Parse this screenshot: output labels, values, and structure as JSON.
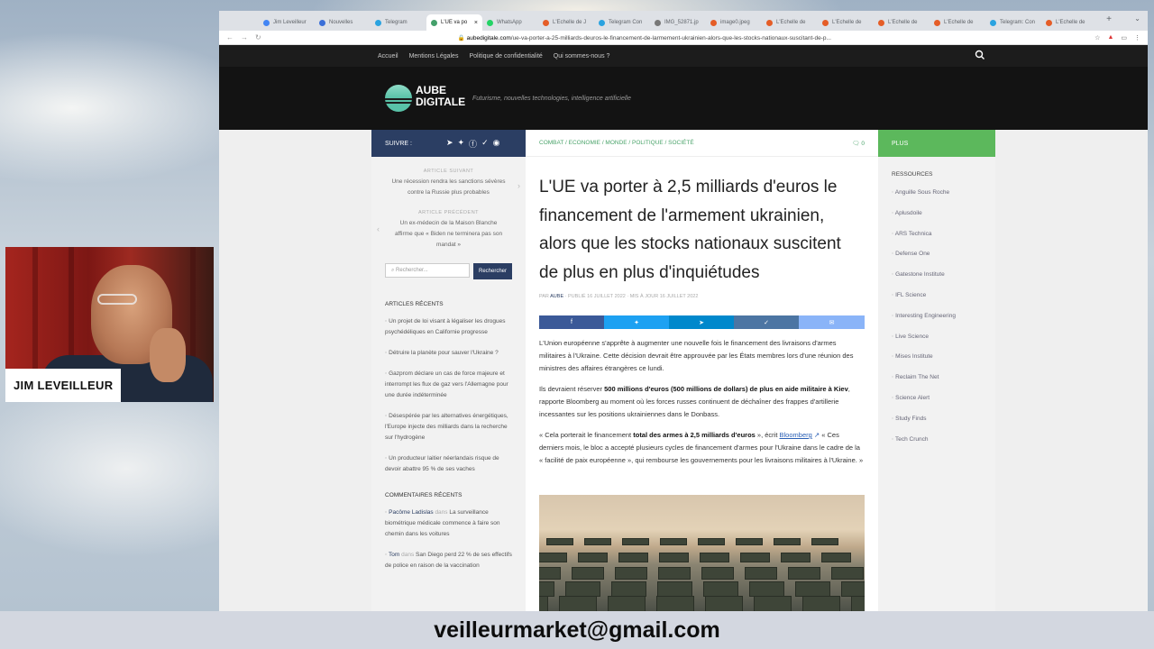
{
  "browser": {
    "tabs": [
      {
        "label": "Jim Leveilleur",
        "color": "#4285f4"
      },
      {
        "label": "Nouvelles",
        "color": "#3a6fd8"
      },
      {
        "label": "Telegram",
        "color": "#2aa3e0"
      },
      {
        "label": "L'UE va po",
        "color": "#44a06b",
        "active": true
      },
      {
        "label": "WhatsApp",
        "color": "#25d366"
      },
      {
        "label": "L'Echelle de J",
        "color": "#e55d27"
      },
      {
        "label": "Telegram Con",
        "color": "#2aa3e0"
      },
      {
        "label": "IMG_52871.jp",
        "color": "#777777"
      },
      {
        "label": "image0.jpeg",
        "color": "#e55d27"
      },
      {
        "label": "L'Echelle de",
        "color": "#e55d27"
      },
      {
        "label": "L'Echelle de",
        "color": "#e55d27"
      },
      {
        "label": "L'Echelle de",
        "color": "#e55d27"
      },
      {
        "label": "L'Echelle de",
        "color": "#e55d27"
      },
      {
        "label": "Telegram: Con",
        "color": "#2aa3e0"
      },
      {
        "label": "L'Echelle de",
        "color": "#e55d27"
      }
    ],
    "url_domain": "aubedigitale.com",
    "url_path": "/ue-va-porter-a-25-milliards-deuros-le-financement-de-larmement-ukrainien-alors-que-les-stocks-nationaux-suscitant-de-p..."
  },
  "site": {
    "topnav": [
      "Accueil",
      "Mentions Légales",
      "Politique de confidentialité",
      "Qui sommes-nous ?"
    ],
    "logo_line1": "AUBE",
    "logo_line2": "DIGITALE",
    "tagline": "Futurisme, nouvelles technologies, intelligence artificielle",
    "suivre": "SUIVRE :",
    "prev_label": "ARTICLE SUIVANT",
    "prev_text": "Une récession rendra les sanctions sévères contre la Russie plus probables",
    "next_label": "ARTICLE PRÉCÉDENT",
    "next_text": "Un ex-médecin de la Maison Blanche affirme que « Biden ne terminera pas son mandat »",
    "search_placeholder": "Rechercher...",
    "search_button": "Rechercher",
    "recent_title": "ARTICLES RÉCENTS",
    "recent": [
      "Un projet de loi visant à légaliser les drogues psychédéliques en Californie progresse",
      "Détruire la planète pour sauver l'Ukraine ?",
      "Gazprom déclare un cas de force majeure et interrompt les flux de gaz vers l'Allemagne pour une durée indéterminée",
      "Désespérée par les alternatives énergétiques, l'Europe injecte des milliards dans la recherche sur l'hydrogène",
      "Un producteur laitier néerlandais risque de devoir abattre 95 % de ses vaches"
    ],
    "comments_title": "COMMENTAIRES RÉCENTS",
    "comments": [
      {
        "author": "Pacôme Ladislas",
        "mid": "dans",
        "text": "La surveillance biométrique médicale commence à faire son chemin dans les voitures"
      },
      {
        "author": "Tom",
        "mid": "dans",
        "text": "San Diego perd 22 % de ses effectifs de police en raison de la vaccination"
      }
    ],
    "breadcrumb": "COMBAT / ECONOMIE / MONDE / POLITIQUE / SOCIÉTÉ",
    "comment_count": "0",
    "title": "L'UE va porter à 2,5 milliards d'euros le financement de l'armement ukrainien, alors que les stocks nationaux suscitent de plus en plus d'inquiétudes",
    "byline_prefix": "PAR",
    "byline_author": "AUBE",
    "byline_rest": "· PUBLIÉ 16 JUILLET 2022 · MIS À JOUR 16 JUILLET 2022",
    "share_colors": [
      "#3b5998",
      "#1da1f2",
      "#0088cc",
      "#4c75a3",
      "#8ab4f8"
    ],
    "p1": "L'Union européenne s'apprête à augmenter une nouvelle fois le financement des livraisons d'armes militaires à l'Ukraine. Cette décision devrait être approuvée par les États membres lors d'une réunion des ministres des affaires étrangères ce lundi.",
    "p2_a": "Ils devraient réserver ",
    "p2_b": "500 millions d'euros (500 millions de dollars) de plus en aide militaire à Kiev",
    "p2_c": ", rapporte Bloomberg au moment où les forces russes continuent de déchaîner des frappes d'artillerie incessantes sur les positions ukrainiennes dans le Donbass.",
    "p3_a": "« Cela porterait le financement ",
    "p3_b": "total des armes à 2,5 milliards d'euros",
    "p3_c": " », écrit ",
    "p3_link": "Bloomberg",
    "p3_d": " « Ces derniers mois, le bloc a accepté plusieurs cycles de financement d'armes pour l'Ukraine dans le cadre de la « facilité de paix européenne », qui rembourse les gouvernements pour les livraisons militaires à l'Ukraine. »",
    "plus": "PLUS",
    "resources_title": "RESSOURCES",
    "resources": [
      "Anguille Sous Roche",
      "Aplusdoile",
      "ARS Technica",
      "Defense One",
      "Gatestone Institute",
      "IFL Science",
      "Interesting Engineering",
      "Live Science",
      "Mises Institute",
      "Reclaim The Net",
      "Science Alert",
      "Study Finds",
      "Tech Crunch"
    ]
  },
  "overlay": {
    "name": "JIM LEVEILLEUR",
    "email": "veilleurmarket@gmail.com"
  }
}
